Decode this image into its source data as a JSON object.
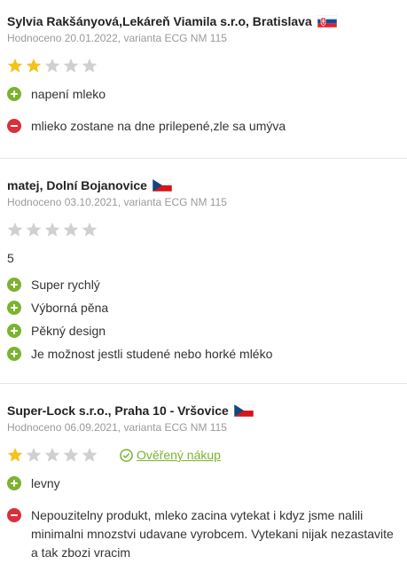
{
  "colors": {
    "pro": "#7bb32e",
    "con": "#d9303c",
    "star_on": "#f4c21b",
    "star_off": "#d0d0d0",
    "verified": "#7bb32e"
  },
  "reviews": [
    {
      "author": "Sylvia Rakšányová,Lekáreň Viamila s.r.o, Bratislava",
      "flag": "slovakia-flag",
      "meta": "Hodnoceno 20.01.2022, varianta ECG NM 115",
      "rating": 2,
      "pros": [
        "napení mleko"
      ],
      "cons": [
        "mlieko zostane na dne prilepené,zle sa umýva"
      ]
    },
    {
      "author": "matej, Dolní Bojanovice",
      "flag": "czech-flag",
      "meta": "Hodnoceno 03.10.2021, varianta ECG NM 115",
      "rating": 0,
      "note": "5",
      "pros": [
        "Super rychlý",
        "Výborná pěna",
        "Pěkný design",
        "Je možnost jestli studené nebo horké mléko"
      ],
      "cons": []
    },
    {
      "author": "Super-Lock s.r.o., Praha 10 - Vršovice",
      "flag": "czech-flag",
      "meta": "Hodnoceno 06.09.2021, varianta ECG NM 115",
      "rating": 1,
      "verified": "Ověřený nákup",
      "pros": [
        "levny"
      ],
      "cons": [
        "Nepouzitelny produkt, mleko zacina vytekat i kdyz jsme nalili minimalni mnozstvi udavane vyrobcem. Vytekani nijak nezastavite a tak zbozi vracim"
      ]
    }
  ]
}
